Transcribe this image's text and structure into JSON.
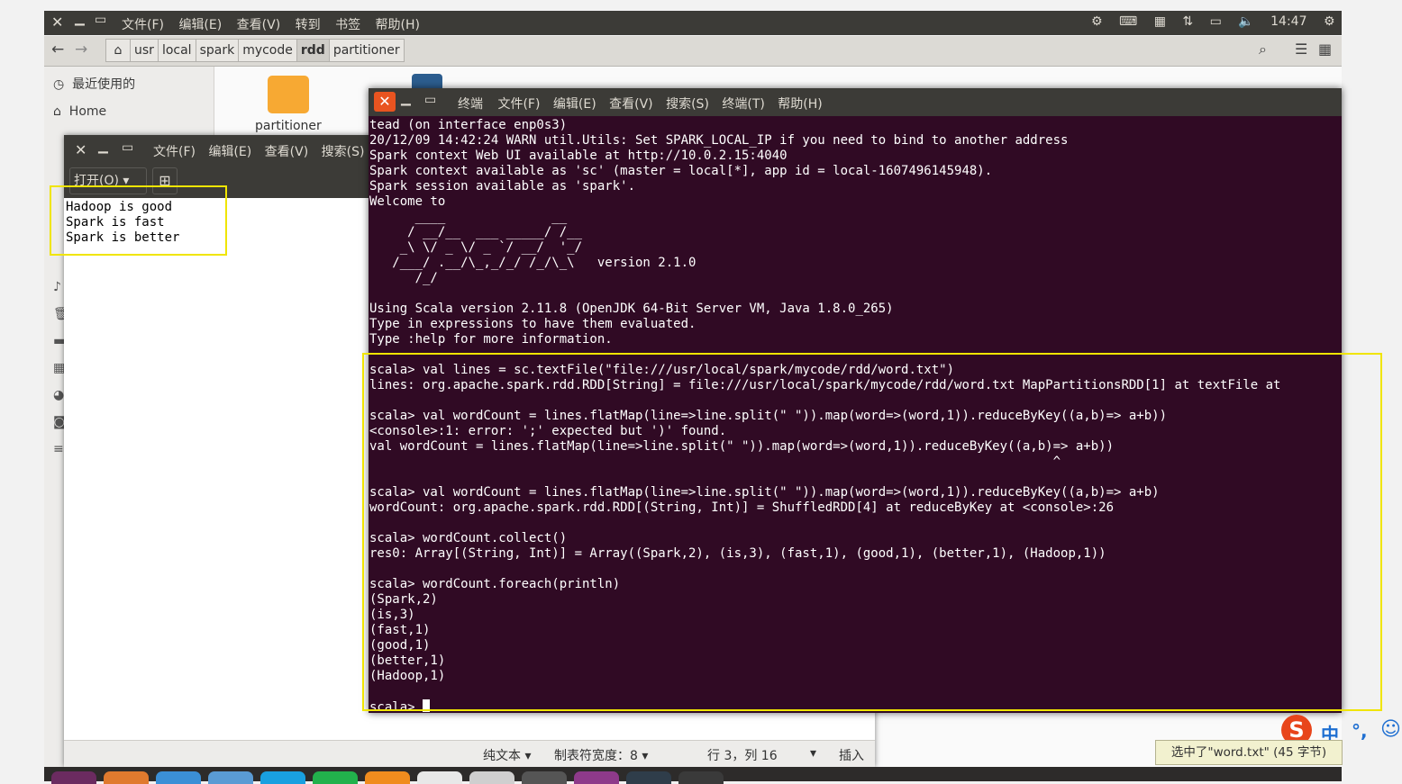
{
  "top_panel": {
    "menu": [
      "文件(F)",
      "编辑(E)",
      "查看(V)",
      "转到",
      "书签",
      "帮助(H)"
    ],
    "time": "14:47"
  },
  "file_manager": {
    "breadcrumbs": [
      "usr",
      "local",
      "spark",
      "mycode",
      "rdd",
      "partitioner"
    ],
    "sidebar": [
      "最近使用的",
      "Home"
    ],
    "folder_label": "partitioner"
  },
  "gedit": {
    "menu": [
      "文件(F)",
      "编辑(E)",
      "查看(V)",
      "搜索(S)"
    ],
    "open_button": "打开(O)",
    "text_lines": [
      "Hadoop is good",
      "Spark is fast",
      "Spark is better"
    ],
    "status": {
      "syntax": "纯文本",
      "tab_width": "制表符宽度：8",
      "position": "行 3，列 16",
      "insert_mode": "插入"
    }
  },
  "terminal": {
    "title": "终端",
    "menu": [
      "文件(F)",
      "编辑(E)",
      "查看(V)",
      "搜索(S)",
      "终端(T)",
      "帮助(H)"
    ],
    "lines": [
      "tead (on interface enp0s3)",
      "20/12/09 14:42:24 WARN util.Utils: Set SPARK_LOCAL_IP if you need to bind to another address",
      "Spark context Web UI available at http://10.0.2.15:4040",
      "Spark context available as 'sc' (master = local[*], app id = local-1607496145948).",
      "Spark session available as 'spark'.",
      "Welcome to",
      "      ____              __",
      "     / __/__  ___ _____/ /__",
      "    _\\ \\/ _ \\/ _ `/ __/  '_/",
      "   /___/ .__/\\_,_/_/ /_/\\_\\   version 2.1.0",
      "      /_/",
      "",
      "Using Scala version 2.11.8 (OpenJDK 64-Bit Server VM, Java 1.8.0_265)",
      "Type in expressions to have them evaluated.",
      "Type :help for more information.",
      "",
      "scala> val lines = sc.textFile(\"file:///usr/local/spark/mycode/rdd/word.txt\")",
      "lines: org.apache.spark.rdd.RDD[String] = file:///usr/local/spark/mycode/rdd/word.txt MapPartitionsRDD[1] at textFile at",
      "",
      "scala> val wordCount = lines.flatMap(line=>line.split(\" \")).map(word=>(word,1)).reduceByKey((a,b)=> a+b))",
      "<console>:1: error: ';' expected but ')' found.",
      "val wordCount = lines.flatMap(line=>line.split(\" \")).map(word=>(word,1)).reduceByKey((a,b)=> a+b))",
      "                                                                                          ^",
      "",
      "scala> val wordCount = lines.flatMap(line=>line.split(\" \")).map(word=>(word,1)).reduceByKey((a,b)=> a+b)",
      "wordCount: org.apache.spark.rdd.RDD[(String, Int)] = ShuffledRDD[4] at reduceByKey at <console>:26",
      "",
      "scala> wordCount.collect()",
      "res0: Array[(String, Int)] = Array((Spark,2), (is,3), (fast,1), (good,1), (better,1), (Hadoop,1))",
      "",
      "scala> wordCount.foreach(println)",
      "(Spark,2)",
      "(is,3)",
      "(fast,1)",
      "(good,1)",
      "(better,1)",
      "(Hadoop,1)",
      "",
      "scala> "
    ]
  },
  "ime": {
    "lang": "中",
    "punct": "°,"
  },
  "tooltip": "选中了\"word.txt\" (45 字节)",
  "colors": {
    "terminal_bg": "#300a24",
    "highlight": "#f0e500",
    "close_button": "#e95420"
  }
}
